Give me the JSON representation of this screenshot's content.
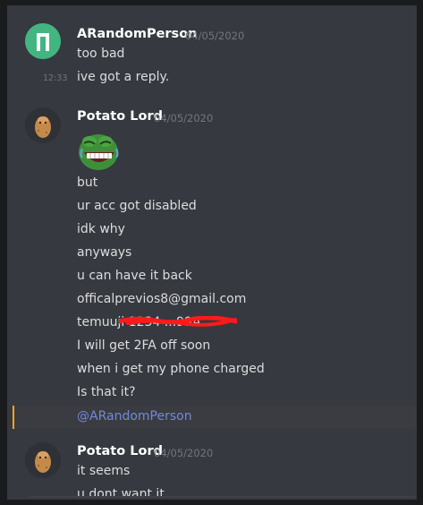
{
  "messages": [
    {
      "username": "ARandomPerson",
      "timestamp": "04/05/2020",
      "lines": [
        "too bad",
        "ive got a reply."
      ],
      "hover_time": "12:33",
      "avatar_color": "#43b581"
    },
    {
      "username": "Potato Lord",
      "timestamp": "04/05/2020",
      "emoji": "pepe-laugh-emoji",
      "lines": [
        "but",
        "ur acc got disabled",
        "idk why",
        "anyways",
        "u can have it back",
        "officalprevios8@gmail.com",
        "temuuji 1234 ...99A",
        "I will get 2FA off soon",
        "when i get my phone charged",
        "Is that it?"
      ],
      "mention": "@ARandomPerson",
      "avatar_color": "#2f3136"
    },
    {
      "username": "Potato Lord",
      "timestamp": "04/05/2020",
      "lines": [
        "it seems",
        "u dont want it"
      ],
      "avatar_color": "#2f3136"
    }
  ],
  "colors": {
    "background": "#36393f",
    "username": "#ffffff",
    "text": "#dcddde",
    "muted": "#72767d",
    "mention": "#7289da",
    "mention_bar": "#faa61a",
    "redaction": "#ff1a1a"
  }
}
